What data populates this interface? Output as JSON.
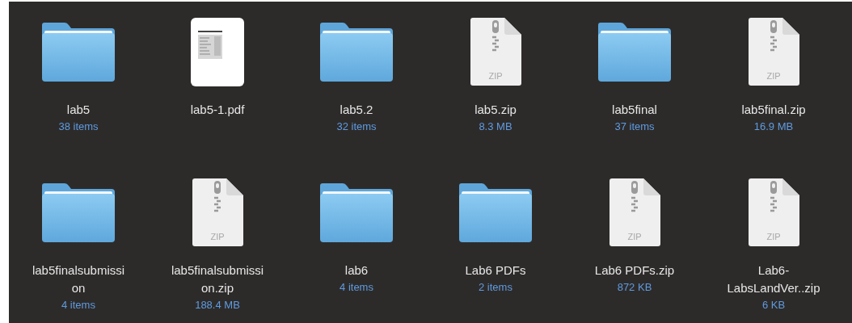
{
  "items": [
    {
      "kind": "folder",
      "name_lines": [
        "lab5"
      ],
      "detail": "38 items"
    },
    {
      "kind": "pdf",
      "name_lines": [
        "lab5-1.pdf"
      ]
    },
    {
      "kind": "folder",
      "name_lines": [
        "lab5.2"
      ],
      "detail": "32 items"
    },
    {
      "kind": "zip",
      "icon_label": "ZIP",
      "name_lines": [
        "lab5.zip"
      ],
      "detail": "8.3 MB"
    },
    {
      "kind": "folder",
      "name_lines": [
        "lab5final"
      ],
      "detail": "37 items"
    },
    {
      "kind": "zip",
      "icon_label": "ZIP",
      "name_lines": [
        "lab5final.zip"
      ],
      "detail": "16.9 MB"
    },
    {
      "kind": "folder",
      "name_lines": [
        "lab5finalsubmissi",
        "on"
      ],
      "detail": "4 items"
    },
    {
      "kind": "zip",
      "icon_label": "ZIP",
      "name_lines": [
        "lab5finalsubmissi",
        "on.zip"
      ],
      "detail": "188.4 MB"
    },
    {
      "kind": "folder",
      "name_lines": [
        "lab6"
      ],
      "detail": "4 items"
    },
    {
      "kind": "folder",
      "name_lines": [
        "Lab6 PDFs"
      ],
      "detail": "2 items"
    },
    {
      "kind": "zip",
      "icon_label": "ZIP",
      "name_lines": [
        "Lab6 PDFs.zip"
      ],
      "detail": "872 KB"
    },
    {
      "kind": "zip",
      "icon_label": "ZIP",
      "name_lines": [
        "Lab6-",
        "LabsLandVer..zip"
      ],
      "detail": "6 KB"
    }
  ]
}
